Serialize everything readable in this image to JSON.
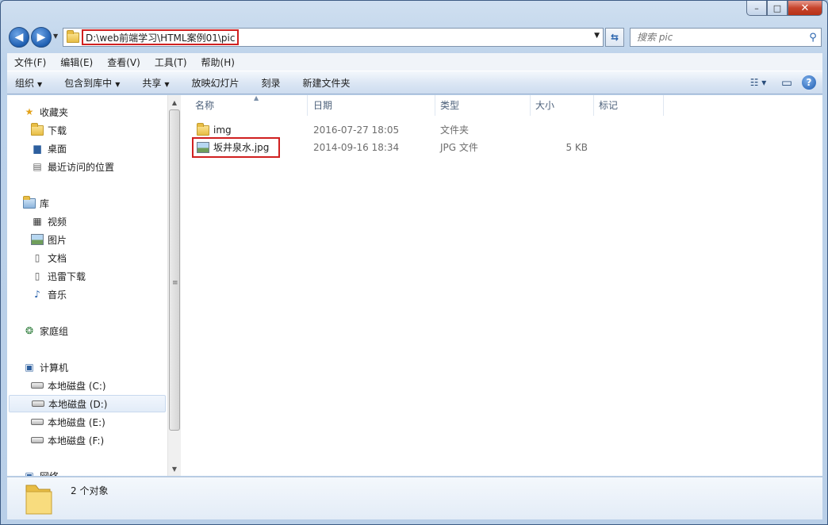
{
  "window": {
    "caption": {
      "minimize": "–",
      "maximize": "□",
      "close": "✕"
    }
  },
  "nav": {
    "back_icon": "arrow-left-icon",
    "forward_icon": "arrow-right-icon",
    "back_glyph": "◀",
    "forward_glyph": "▶",
    "address": "D:\\web前端学习\\HTML案例01\\pic",
    "refresh_glyph": "⇆",
    "search_placeholder": "搜索 pic",
    "search_glyph": "⚲"
  },
  "menu": [
    "文件(F)",
    "编辑(E)",
    "查看(V)",
    "工具(T)",
    "帮助(H)"
  ],
  "commands": [
    {
      "label": "组织",
      "dropdown": true
    },
    {
      "label": "包含到库中",
      "dropdown": true
    },
    {
      "label": "共享",
      "dropdown": true
    },
    {
      "label": "放映幻灯片",
      "dropdown": false
    },
    {
      "label": "刻录",
      "dropdown": false
    },
    {
      "label": "新建文件夹",
      "dropdown": false
    }
  ],
  "command_icons": {
    "views": "☷ ▾",
    "preview": "▭",
    "help": "?"
  },
  "sidebar": {
    "favorites": "收藏夹",
    "downloads": "下载",
    "desktop": "桌面",
    "recent": "最近访问的位置",
    "libraries": "库",
    "videos": "视频",
    "pictures": "图片",
    "documents": "文档",
    "thunder": "迅雷下载",
    "music": "音乐",
    "homegroup": "家庭组",
    "computer": "计算机",
    "drive_c": "本地磁盘 (C:)",
    "drive_d": "本地磁盘 (D:)",
    "drive_e": "本地磁盘 (E:)",
    "drive_f": "本地磁盘 (F:)",
    "network": "网络"
  },
  "columns": {
    "name": "名称",
    "date": "日期",
    "type": "类型",
    "size": "大小",
    "tags": "标记"
  },
  "files": [
    {
      "name": "img",
      "date": "2016-07-27 18:05",
      "type": "文件夹",
      "size": "",
      "icon": "folder-icon"
    },
    {
      "name": "坂井泉水.jpg",
      "date": "2014-09-16 18:34",
      "type": "JPG 文件",
      "size": "5 KB",
      "icon": "image-file-icon"
    }
  ],
  "status": {
    "count": "2 个对象"
  },
  "colors": {
    "highlight_border": "#d02020",
    "frame": "#b9cfe8"
  }
}
